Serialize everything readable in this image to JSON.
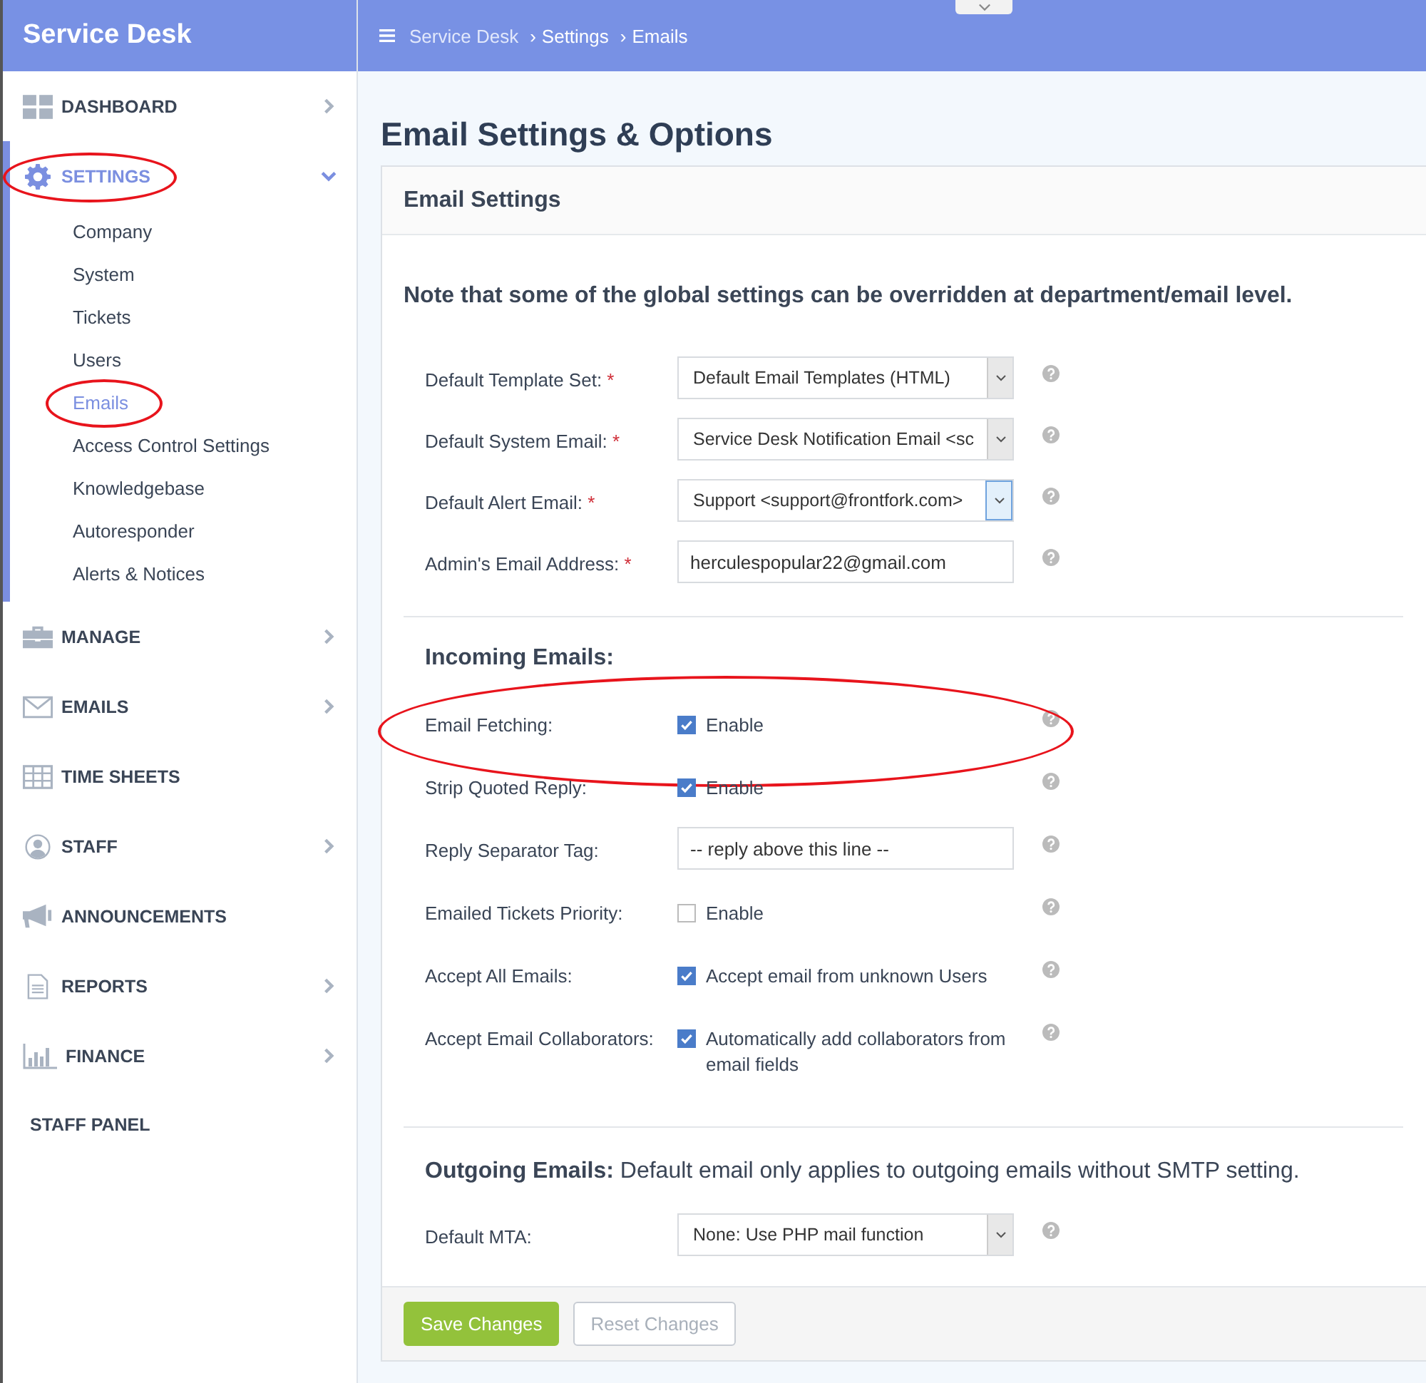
{
  "app_title": "Service Desk",
  "breadcrumb": [
    "Service Desk",
    "Settings",
    "Emails"
  ],
  "breadcrumb_separator": "›",
  "sidebar": {
    "items": [
      {
        "label": "DASHBOARD",
        "kind": "dashboard",
        "has_submenu": true,
        "expanded": false,
        "selected": false,
        "circled": false
      },
      {
        "label": "SETTINGS",
        "kind": "settings",
        "has_submenu": true,
        "expanded": true,
        "selected": true,
        "circled": true,
        "children": [
          {
            "label": "Company",
            "selected": false,
            "circled": false
          },
          {
            "label": "System",
            "selected": false,
            "circled": false
          },
          {
            "label": "Tickets",
            "selected": false,
            "circled": false
          },
          {
            "label": "Users",
            "selected": false,
            "circled": false
          },
          {
            "label": "Emails",
            "selected": true,
            "circled": true
          },
          {
            "label": "Access Control Settings",
            "selected": false,
            "circled": false
          },
          {
            "label": "Knowledgebase",
            "selected": false,
            "circled": false
          },
          {
            "label": "Autoresponder",
            "selected": false,
            "circled": false
          },
          {
            "label": "Alerts & Notices",
            "selected": false,
            "circled": false
          }
        ]
      },
      {
        "label": "MANAGE",
        "kind": "manage",
        "has_submenu": true,
        "expanded": false,
        "selected": false,
        "circled": false
      },
      {
        "label": "EMAILS",
        "kind": "emails",
        "has_submenu": true,
        "expanded": false,
        "selected": false,
        "circled": false
      },
      {
        "label": "TIME SHEETS",
        "kind": "timesheets",
        "has_submenu": false,
        "selected": false,
        "circled": false
      },
      {
        "label": "STAFF",
        "kind": "staff",
        "has_submenu": true,
        "expanded": false,
        "selected": false,
        "circled": false
      },
      {
        "label": "ANNOUNCEMENTS",
        "kind": "announcements",
        "has_submenu": false,
        "selected": false,
        "circled": false
      },
      {
        "label": "REPORTS",
        "kind": "reports",
        "has_submenu": true,
        "expanded": false,
        "selected": false,
        "circled": false
      },
      {
        "label": "FINANCE",
        "kind": "finance",
        "has_submenu": true,
        "expanded": false,
        "selected": false,
        "circled": false
      }
    ],
    "footer": "STAFF PANEL"
  },
  "page_title": "Email Settings & Options",
  "panel": {
    "title": "Email Settings",
    "sections": [
      {
        "heading": "Note that some of the global settings can be overridden at department/email level.",
        "rows": [
          {
            "kind": "select",
            "label": "Default Template Set:",
            "required_mark": "*",
            "value": "Default Email Templates (HTML)",
            "focused": false,
            "circled": false
          },
          {
            "kind": "select",
            "label": "Default System Email:",
            "required_mark": "*",
            "value": "Service Desk Notification Email <sc",
            "focused": false,
            "circled": false
          },
          {
            "kind": "select",
            "label": "Default Alert Email:",
            "required_mark": "*",
            "value": "Support <support@frontfork.com>",
            "focused": true,
            "circled": false
          },
          {
            "kind": "text",
            "label": "Admin's Email Address:",
            "required_mark": "*",
            "value": "herculespopular22@gmail.com",
            "circled": false
          }
        ]
      },
      {
        "heading": "Incoming Emails:",
        "rows": [
          {
            "kind": "checkbox",
            "label": "Email Fetching:",
            "checked": true,
            "option": "Enable",
            "circled": true
          },
          {
            "kind": "checkbox",
            "label": "Strip Quoted Reply:",
            "checked": true,
            "option": "Enable",
            "circled": false
          },
          {
            "kind": "text",
            "label": "Reply Separator Tag:",
            "value": "-- reply above this line --",
            "circled": false
          },
          {
            "kind": "checkbox",
            "label": "Emailed Tickets Priority:",
            "checked": false,
            "option": "Enable",
            "circled": false
          },
          {
            "kind": "checkbox",
            "label": "Accept All Emails:",
            "checked": true,
            "option": "Accept email from unknown Users",
            "circled": false
          },
          {
            "kind": "checkbox",
            "label": "Accept Email Collaborators:",
            "checked": true,
            "option": "Automatically add collaborators from email fields",
            "circled": false
          }
        ]
      },
      {
        "heading": "**Outgoing Emails:** Default email only applies to outgoing emails without SMTP setting.",
        "rows": [
          {
            "kind": "select",
            "label": "Default MTA:",
            "value": "None: Use PHP mail function",
            "focused": false,
            "circled": false
          }
        ]
      }
    ],
    "buttons": [
      {
        "label": "Save Changes",
        "disabled": false
      },
      {
        "label": "Reset Changes",
        "disabled": true
      }
    ]
  }
}
